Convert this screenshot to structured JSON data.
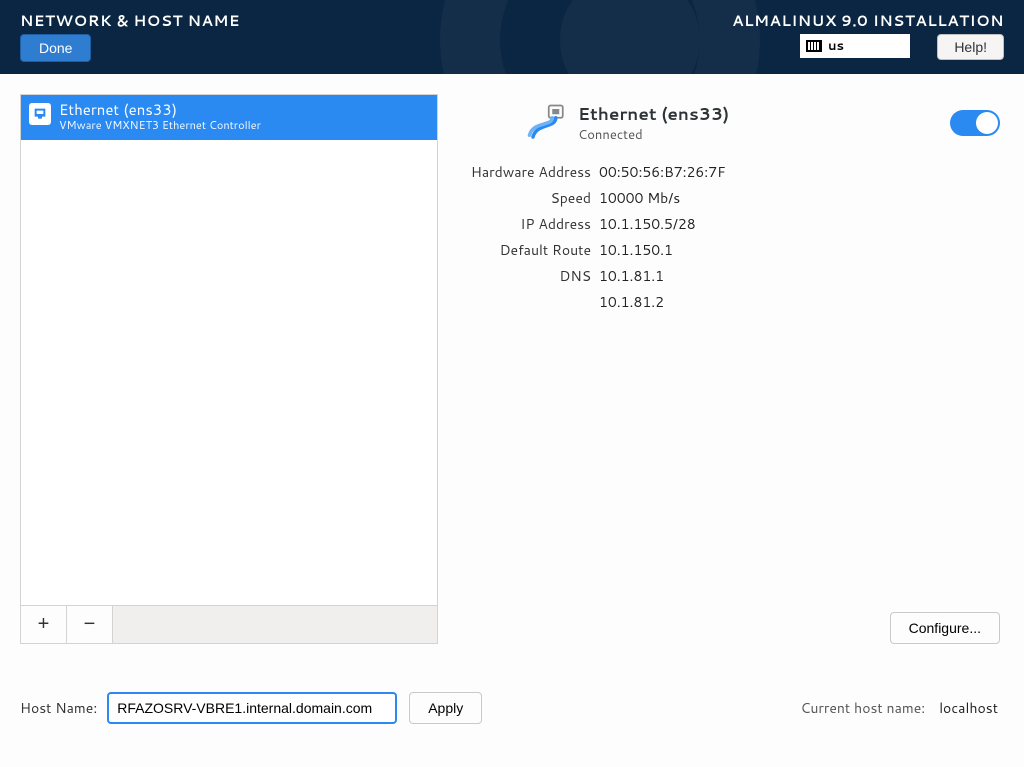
{
  "header": {
    "title": "NETWORK & HOST NAME",
    "done": "Done",
    "installer": "ALMALINUX 9.0 INSTALLATION",
    "keyboard_layout": "us",
    "help": "Help!"
  },
  "interface_list": {
    "items": [
      {
        "name": "Ethernet (ens33)",
        "subtitle": "VMware VMXNET3 Ethernet Controller"
      }
    ],
    "add_label": "+",
    "remove_label": "−"
  },
  "details": {
    "name": "Ethernet (ens33)",
    "status": "Connected",
    "toggle_on": true,
    "rows": {
      "hw_addr_label": "Hardware Address",
      "hw_addr": "00:50:56:B7:26:7F",
      "speed_label": "Speed",
      "speed": "10000 Mb/s",
      "ip_label": "IP Address",
      "ip": "10.1.150.5/28",
      "route_label": "Default Route",
      "route": "10.1.150.1",
      "dns_label": "DNS",
      "dns1": "10.1.81.1",
      "dns2": "10.1.81.2"
    },
    "configure": "Configure..."
  },
  "footer": {
    "hostname_label": "Host Name:",
    "hostname_value": "RFAZOSRV-VBRE1.internal.domain.com",
    "apply": "Apply",
    "current_label": "Current host name:",
    "current_value": "localhost"
  }
}
